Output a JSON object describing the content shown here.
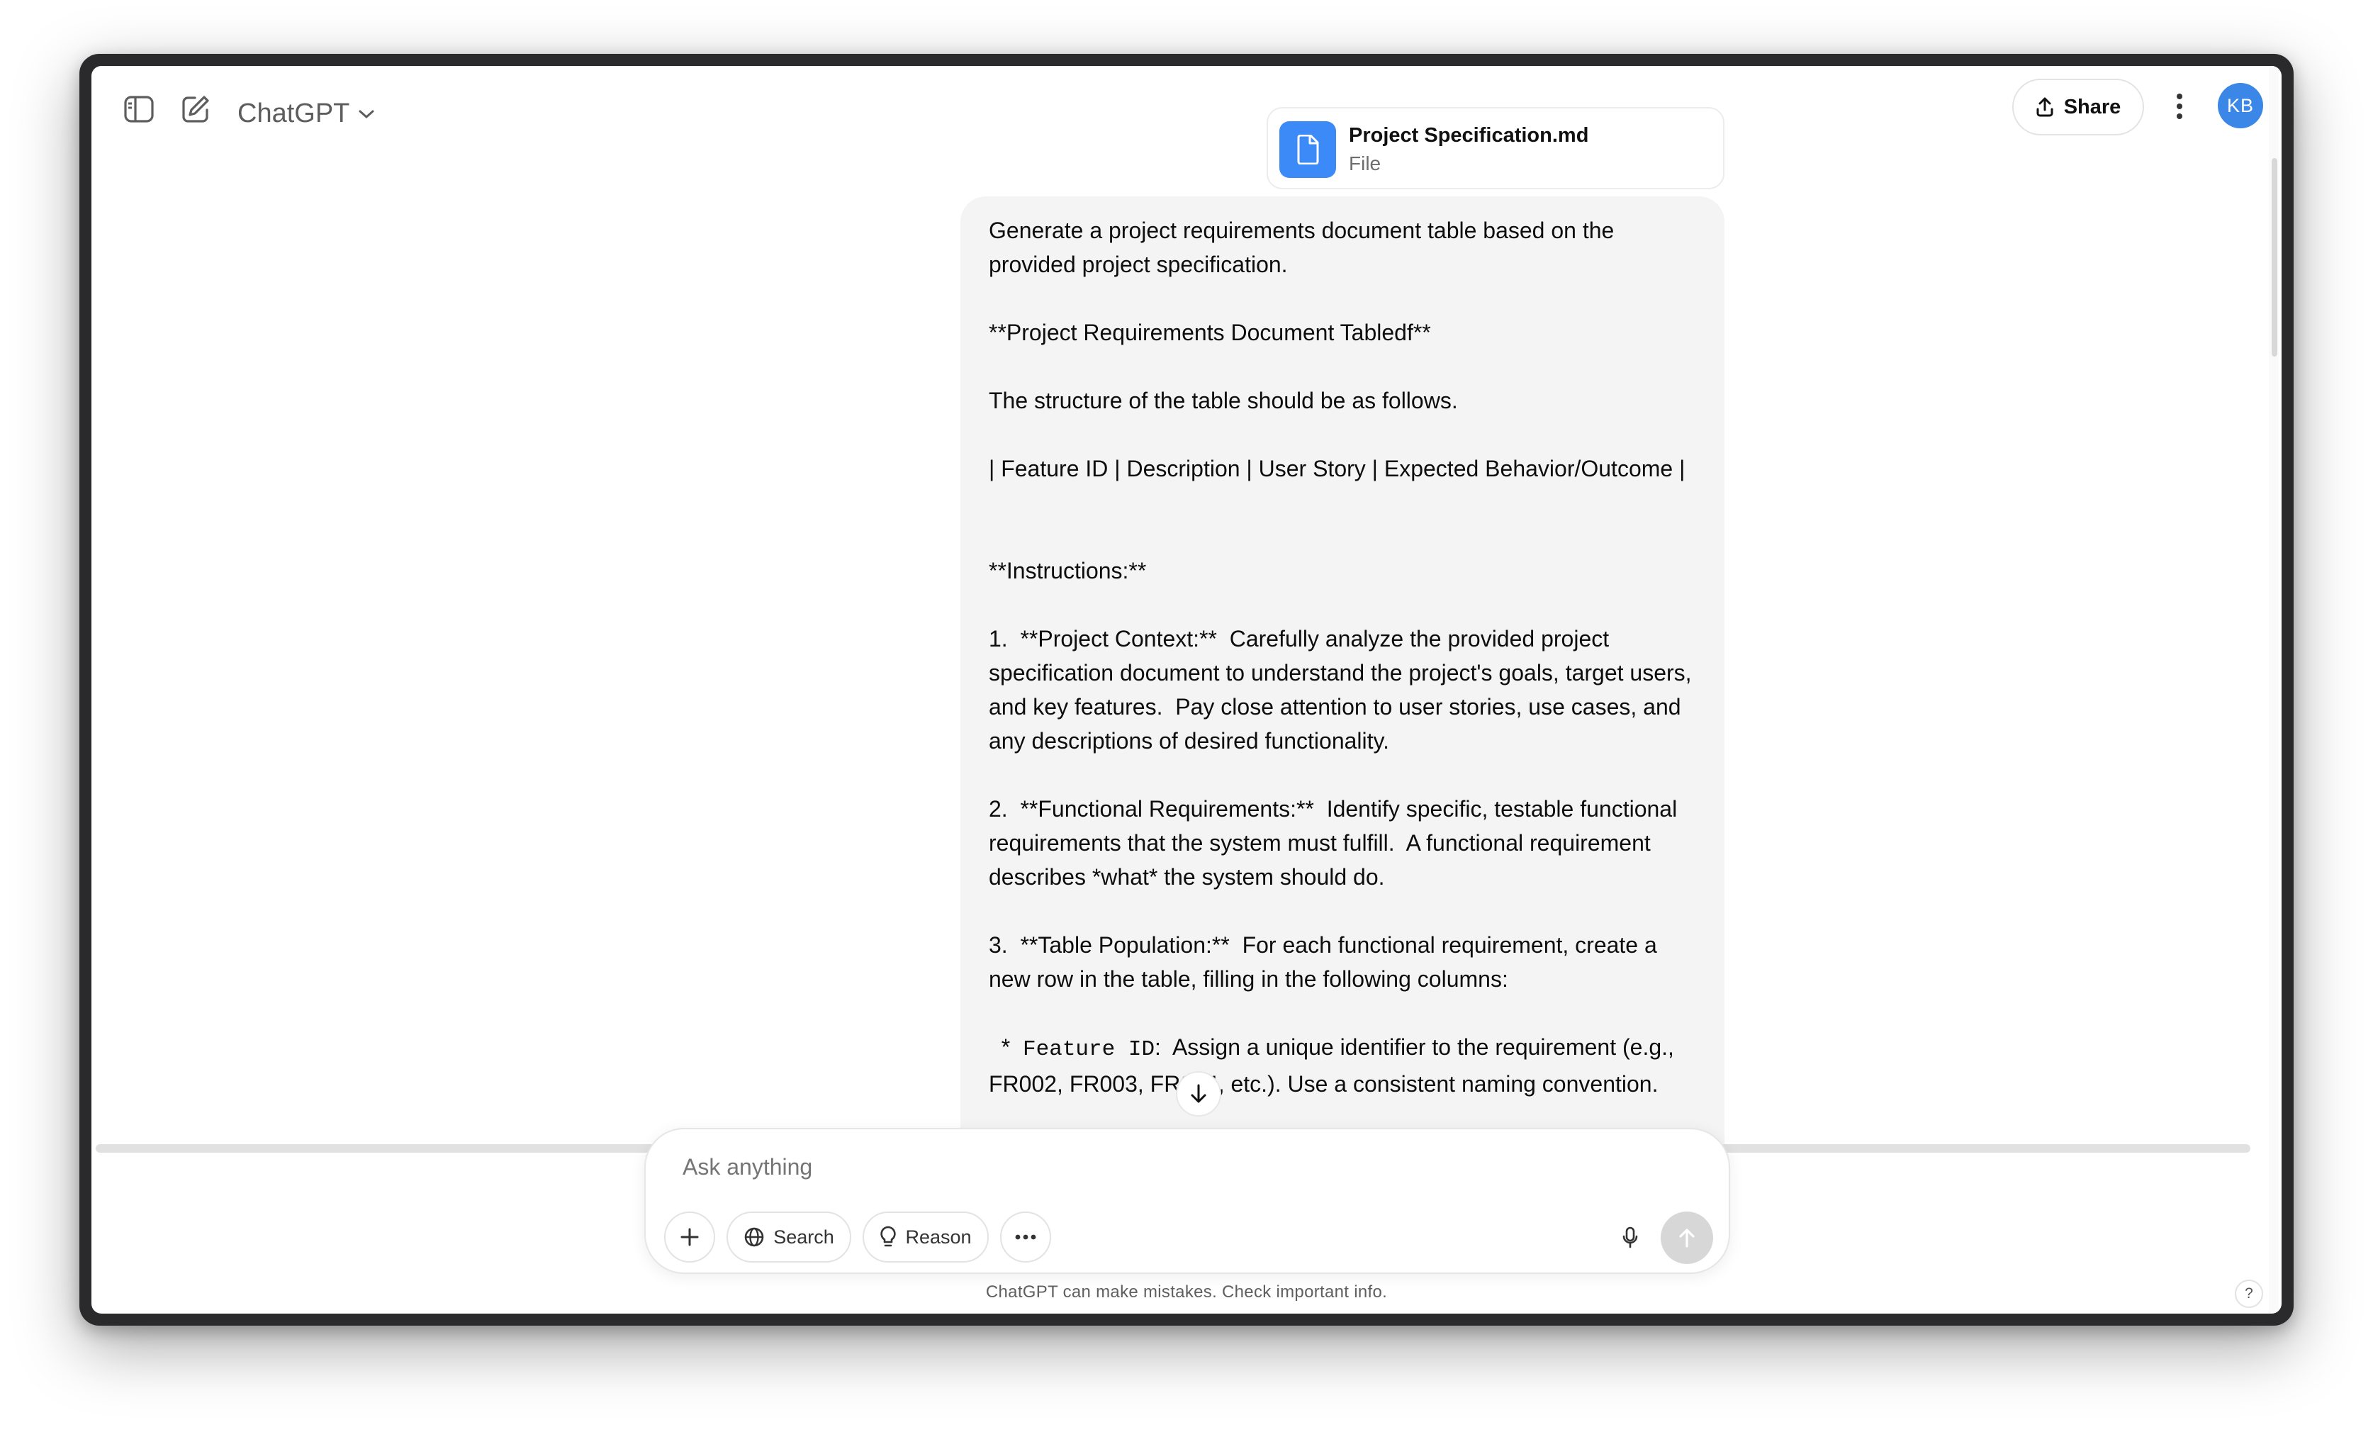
{
  "header": {
    "app_title": "ChatGPT",
    "share_label": "Share",
    "avatar_initials": "KB"
  },
  "attachment": {
    "name": "Project Specification.md",
    "type": "File"
  },
  "message": {
    "p1": "Generate a project requirements document table based on the provided project specification.",
    "p2": "**Project Requirements Document Tabledf**",
    "p3": "The structure of the table should be as follows.",
    "p4": "| Feature ID | Description | User Story | Expected Behavior/Outcome |",
    "p5": "**Instructions:**",
    "p6": "1.  **Project Context:**  Carefully analyze the provided project specification document to understand the project's goals, target users, and key features.  Pay close attention to user stories, use cases, and any descriptions of desired functionality.",
    "p7": "2.  **Functional Requirements:**  Identify specific, testable functional requirements that the system must fulfill.  A functional requirement describes *what* the system should do.",
    "p8": "3.  **Table Population:**  For each functional requirement, create a new row in the table, filling in the following columns:",
    "p9_prefix": "  *  ",
    "p9_code": "Feature ID",
    "p9_rest": ":  Assign a unique identifier to the requirement (e.g., FR002, FR003, FR004, etc.). Use a consistent naming convention."
  },
  "composer": {
    "placeholder": "Ask anything",
    "search_label": "Search",
    "reason_label": "Reason"
  },
  "footer": {
    "disclaimer": "ChatGPT can make mistakes. Check important info.",
    "help": "?"
  },
  "icons": [
    "sidebar-toggle-icon",
    "new-chat-icon",
    "chevron-down-icon",
    "share-icon",
    "more-vertical-icon",
    "file-icon",
    "arrow-down-icon",
    "plus-icon",
    "globe-icon",
    "lightbulb-icon",
    "ellipsis-icon",
    "microphone-icon",
    "arrow-up-icon"
  ],
  "colors": {
    "accent": "#3b87e8",
    "bubble": "#f4f4f4",
    "file_icon_bg": "#3b8af7"
  }
}
